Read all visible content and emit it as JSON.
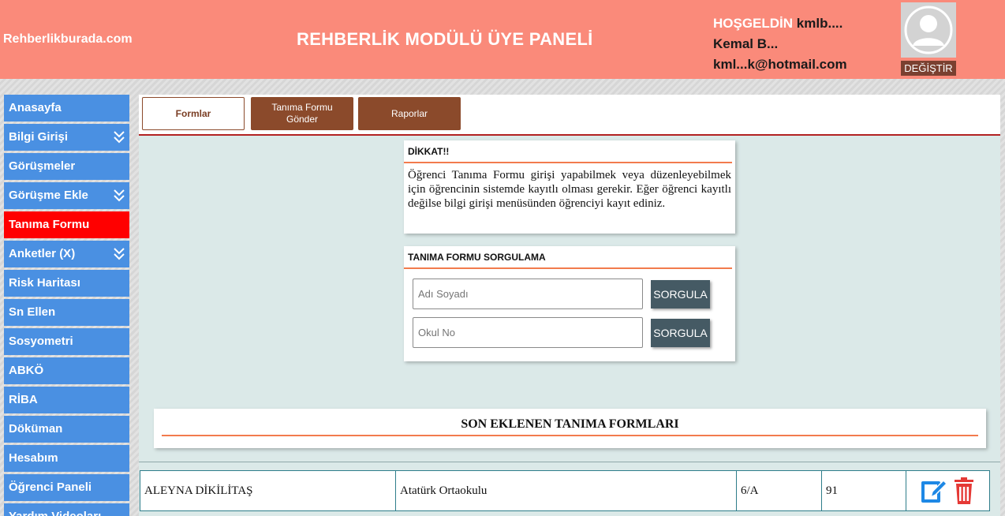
{
  "header": {
    "site_name": "Rehberlikburada.com",
    "title": "REHBERLİK MODÜLÜ ÜYE PANELİ",
    "welcome_label": "HOŞGELDİN",
    "username": "kmlb....",
    "full_name": "Kemal B...",
    "email": "kml...k@hotmail.com",
    "change_label": "DEĞİŞTİR"
  },
  "sidebar": {
    "items": [
      {
        "label": "Anasayfa"
      },
      {
        "label": "Bilgi Girişi"
      },
      {
        "label": "Görüşmeler"
      },
      {
        "label": "Görüşme Ekle"
      },
      {
        "label": "Tanıma Formu"
      },
      {
        "label": "Anketler (X)"
      },
      {
        "label": "Risk Haritası"
      },
      {
        "label": "Sn Ellen"
      },
      {
        "label": "Sosyometri"
      },
      {
        "label": "ABKÖ"
      },
      {
        "label": "RİBA"
      },
      {
        "label": "Döküman"
      },
      {
        "label": "Hesabım"
      },
      {
        "label": "Öğrenci Paneli"
      },
      {
        "label": "Yardım Videoları"
      }
    ]
  },
  "tabs": [
    {
      "label": "Formlar"
    },
    {
      "label": "Tanıma Formu Gönder"
    },
    {
      "label": "Raporlar"
    }
  ],
  "notice": {
    "title": "DİKKAT!!",
    "text": "Öğrenci Tanıma Formu girişi yapabilmek veya düzenleyebilmek için öğrencinin sistemde kayıtlı olması gerekir. Eğer öğrenci kayıtlı değilse bilgi girişi menüsünden öğrenciyi kayıt ediniz."
  },
  "query": {
    "title": "TANIMA FORMU SORGULAMA",
    "name_placeholder": "Adı Soyadı",
    "number_placeholder": "Okul No",
    "button_label": "SORGULA"
  },
  "recent": {
    "title": "SON EKLENEN TANIMA FORMLARI",
    "rows": [
      {
        "name": "ALEYNA DİKİLİTAŞ",
        "school": "Atatürk Ortaokulu",
        "class": "6/A",
        "number": "91"
      }
    ]
  },
  "colors": {
    "header_bg": "#fa8a7a",
    "sidebar_bg": "#4a90e2",
    "sidebar_active": "#ff0000",
    "tab_brown": "#8b4a2b",
    "accent_orange": "#f27b4d",
    "button_slate": "#455a64"
  }
}
